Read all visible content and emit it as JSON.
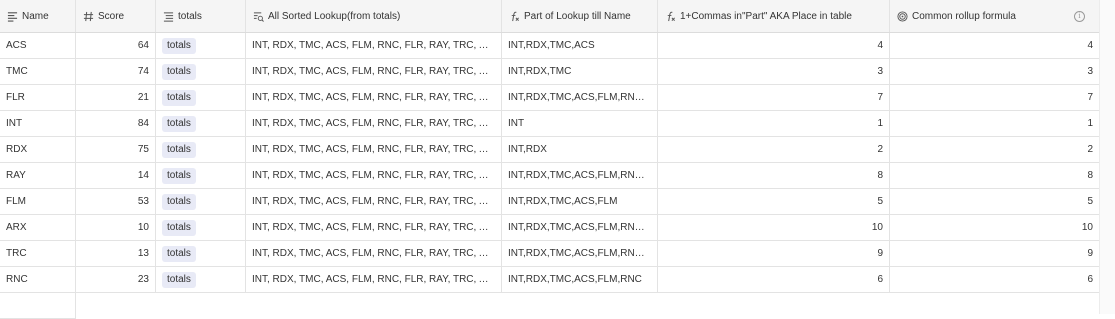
{
  "columns": [
    {
      "label": "Name",
      "icon": "text-lines-icon"
    },
    {
      "label": "Score",
      "icon": "hash-icon"
    },
    {
      "label": "totals",
      "icon": "link-list-icon"
    },
    {
      "label": "All Sorted Lookup(from totals)",
      "icon": "lookup-icon"
    },
    {
      "label": "Part of Lookup till Name",
      "icon": "formula-icon"
    },
    {
      "label": "1+Commas in\"Part\" AKA Place in table",
      "icon": "formula-icon"
    },
    {
      "label": "Common rollup formula",
      "icon": "rollup-icon"
    }
  ],
  "info_glyph": "i",
  "rows": [
    {
      "name": "ACS",
      "score": "64",
      "totals": "totals",
      "lookup": "INT, RDX, TMC, ACS, FLM, RNC, FLR, RAY, TRC, ARX",
      "part": "INT,RDX,TMC,ACS",
      "place": "4",
      "rollup": "4"
    },
    {
      "name": "TMC",
      "score": "74",
      "totals": "totals",
      "lookup": "INT, RDX, TMC, ACS, FLM, RNC, FLR, RAY, TRC, ARX",
      "part": "INT,RDX,TMC",
      "place": "3",
      "rollup": "3"
    },
    {
      "name": "FLR",
      "score": "21",
      "totals": "totals",
      "lookup": "INT, RDX, TMC, ACS, FLM, RNC, FLR, RAY, TRC, ARX",
      "part": "INT,RDX,TMC,ACS,FLM,RNC,FLR",
      "place": "7",
      "rollup": "7"
    },
    {
      "name": "INT",
      "score": "84",
      "totals": "totals",
      "lookup": "INT, RDX, TMC, ACS, FLM, RNC, FLR, RAY, TRC, ARX",
      "part": "INT",
      "place": "1",
      "rollup": "1"
    },
    {
      "name": "RDX",
      "score": "75",
      "totals": "totals",
      "lookup": "INT, RDX, TMC, ACS, FLM, RNC, FLR, RAY, TRC, ARX",
      "part": "INT,RDX",
      "place": "2",
      "rollup": "2"
    },
    {
      "name": "RAY",
      "score": "14",
      "totals": "totals",
      "lookup": "INT, RDX, TMC, ACS, FLM, RNC, FLR, RAY, TRC, ARX",
      "part": "INT,RDX,TMC,ACS,FLM,RNC,F...",
      "place": "8",
      "rollup": "8"
    },
    {
      "name": "FLM",
      "score": "53",
      "totals": "totals",
      "lookup": "INT, RDX, TMC, ACS, FLM, RNC, FLR, RAY, TRC, ARX",
      "part": "INT,RDX,TMC,ACS,FLM",
      "place": "5",
      "rollup": "5"
    },
    {
      "name": "ARX",
      "score": "10",
      "totals": "totals",
      "lookup": "INT, RDX, TMC, ACS, FLM, RNC, FLR, RAY, TRC, ARX",
      "part": "INT,RDX,TMC,ACS,FLM,RNC,F...",
      "place": "10",
      "rollup": "10"
    },
    {
      "name": "TRC",
      "score": "13",
      "totals": "totals",
      "lookup": "INT, RDX, TMC, ACS, FLM, RNC, FLR, RAY, TRC, ARX",
      "part": "INT,RDX,TMC,ACS,FLM,RNC,F...",
      "place": "9",
      "rollup": "9"
    },
    {
      "name": "RNC",
      "score": "23",
      "totals": "totals",
      "lookup": "INT, RDX, TMC, ACS, FLM, RNC, FLR, RAY, TRC, ARX",
      "part": "INT,RDX,TMC,ACS,FLM,RNC",
      "place": "6",
      "rollup": "6"
    }
  ],
  "colors": {
    "pill_bg": "#e8eaf6",
    "header_bg": "#f5f5f5",
    "border": "#e3e3e3"
  }
}
